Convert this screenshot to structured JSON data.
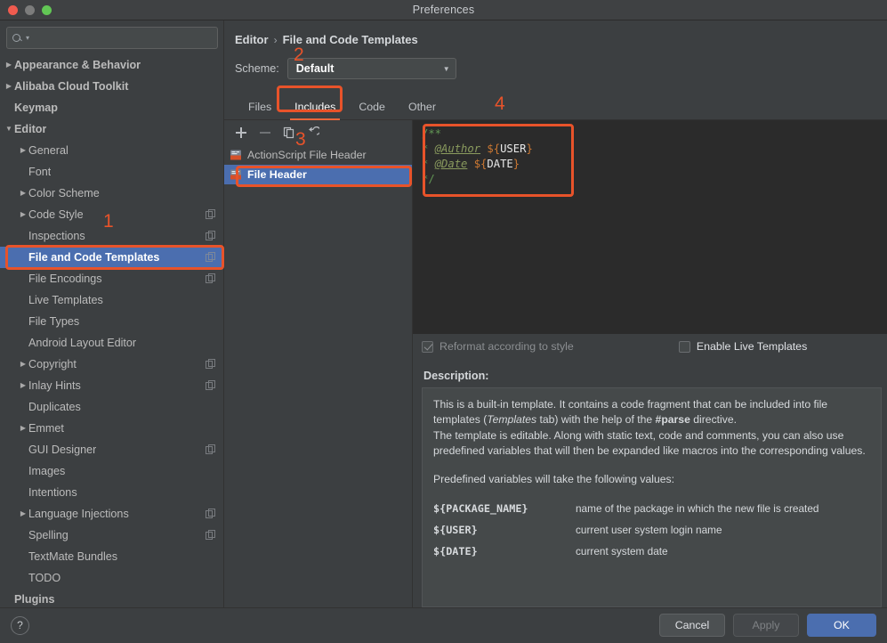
{
  "window": {
    "title": "Preferences",
    "controls": [
      "close",
      "minimize",
      "zoom"
    ]
  },
  "search": {
    "value": "",
    "placeholder": ""
  },
  "sidebar": {
    "items": [
      {
        "label": "Appearance & Behavior",
        "level": 0,
        "arrow": "collapsed",
        "bold": true,
        "cfg": false,
        "selected": false
      },
      {
        "label": "Alibaba Cloud Toolkit",
        "level": 0,
        "arrow": "collapsed",
        "bold": true,
        "cfg": false,
        "selected": false
      },
      {
        "label": "Keymap",
        "level": 0,
        "arrow": "none",
        "bold": true,
        "cfg": false,
        "selected": false
      },
      {
        "label": "Editor",
        "level": 0,
        "arrow": "expanded",
        "bold": true,
        "cfg": false,
        "selected": false
      },
      {
        "label": "General",
        "level": 1,
        "arrow": "collapsed",
        "bold": false,
        "cfg": false,
        "selected": false
      },
      {
        "label": "Font",
        "level": 1,
        "arrow": "none",
        "bold": false,
        "cfg": false,
        "selected": false
      },
      {
        "label": "Color Scheme",
        "level": 1,
        "arrow": "collapsed",
        "bold": false,
        "cfg": false,
        "selected": false
      },
      {
        "label": "Code Style",
        "level": 1,
        "arrow": "collapsed",
        "bold": false,
        "cfg": true,
        "selected": false
      },
      {
        "label": "Inspections",
        "level": 1,
        "arrow": "none",
        "bold": false,
        "cfg": true,
        "selected": false
      },
      {
        "label": "File and Code Templates",
        "level": 1,
        "arrow": "none",
        "bold": false,
        "cfg": true,
        "selected": true
      },
      {
        "label": "File Encodings",
        "level": 1,
        "arrow": "none",
        "bold": false,
        "cfg": true,
        "selected": false
      },
      {
        "label": "Live Templates",
        "level": 1,
        "arrow": "none",
        "bold": false,
        "cfg": false,
        "selected": false
      },
      {
        "label": "File Types",
        "level": 1,
        "arrow": "none",
        "bold": false,
        "cfg": false,
        "selected": false
      },
      {
        "label": "Android Layout Editor",
        "level": 1,
        "arrow": "none",
        "bold": false,
        "cfg": false,
        "selected": false
      },
      {
        "label": "Copyright",
        "level": 1,
        "arrow": "collapsed",
        "bold": false,
        "cfg": true,
        "selected": false
      },
      {
        "label": "Inlay Hints",
        "level": 1,
        "arrow": "collapsed",
        "bold": false,
        "cfg": true,
        "selected": false
      },
      {
        "label": "Duplicates",
        "level": 1,
        "arrow": "none",
        "bold": false,
        "cfg": false,
        "selected": false
      },
      {
        "label": "Emmet",
        "level": 1,
        "arrow": "collapsed",
        "bold": false,
        "cfg": false,
        "selected": false
      },
      {
        "label": "GUI Designer",
        "level": 1,
        "arrow": "none",
        "bold": false,
        "cfg": true,
        "selected": false
      },
      {
        "label": "Images",
        "level": 1,
        "arrow": "none",
        "bold": false,
        "cfg": false,
        "selected": false
      },
      {
        "label": "Intentions",
        "level": 1,
        "arrow": "none",
        "bold": false,
        "cfg": false,
        "selected": false
      },
      {
        "label": "Language Injections",
        "level": 1,
        "arrow": "collapsed",
        "bold": false,
        "cfg": true,
        "selected": false
      },
      {
        "label": "Spelling",
        "level": 1,
        "arrow": "none",
        "bold": false,
        "cfg": true,
        "selected": false
      },
      {
        "label": "TextMate Bundles",
        "level": 1,
        "arrow": "none",
        "bold": false,
        "cfg": false,
        "selected": false
      },
      {
        "label": "TODO",
        "level": 1,
        "arrow": "none",
        "bold": false,
        "cfg": false,
        "selected": false
      },
      {
        "label": "Plugins",
        "level": 0,
        "arrow": "none",
        "bold": true,
        "cfg": false,
        "selected": false
      }
    ]
  },
  "main": {
    "breadcrumb": {
      "parent": "Editor",
      "separator": "›",
      "current": "File and Code Templates"
    },
    "scheme": {
      "label": "Scheme:",
      "value": "Default",
      "arrow": "▼"
    },
    "tabs": [
      {
        "label": "Files",
        "active": false
      },
      {
        "label": "Includes",
        "active": true
      },
      {
        "label": "Code",
        "active": false
      },
      {
        "label": "Other",
        "active": false
      }
    ],
    "list_toolbar": [
      {
        "name": "add",
        "glyph": "+",
        "enabled": true
      },
      {
        "name": "remove",
        "glyph": "−",
        "enabled": false
      },
      {
        "name": "copy",
        "glyph": "copy",
        "enabled": true
      },
      {
        "name": "reset",
        "glyph": "revert",
        "enabled": true
      }
    ],
    "templates": [
      {
        "label": "ActionScript File Header",
        "selected": false
      },
      {
        "label": "File Header",
        "selected": true
      }
    ],
    "code": {
      "lines": [
        {
          "segments": [
            {
              "text": "/**",
              "cls": "c-comment"
            }
          ]
        },
        {
          "segments": [
            {
              "text": " * ",
              "cls": "c-comment"
            },
            {
              "text": "@Author",
              "cls": "c-tag"
            },
            {
              "text": " ",
              "cls": "c-comment"
            },
            {
              "text": "${",
              "cls": "c-var"
            },
            {
              "text": "USER",
              "cls": "c-varname"
            },
            {
              "text": "}",
              "cls": "c-var"
            }
          ]
        },
        {
          "segments": [
            {
              "text": " * ",
              "cls": "c-comment"
            },
            {
              "text": "@Date",
              "cls": "c-tag"
            },
            {
              "text": " ",
              "cls": "c-comment"
            },
            {
              "text": "${",
              "cls": "c-var"
            },
            {
              "text": "DATE",
              "cls": "c-varname"
            },
            {
              "text": "}",
              "cls": "c-var"
            }
          ]
        },
        {
          "segments": [
            {
              "text": " */",
              "cls": "c-comment"
            }
          ]
        }
      ]
    },
    "options": {
      "reformat": {
        "label": "Reformat according to style",
        "checked": true,
        "enabled": false
      },
      "live_templates": {
        "label": "Enable Live Templates",
        "checked": false,
        "enabled": true
      }
    },
    "description": {
      "label": "Description:",
      "para1_a": "This is a built-in template. It contains a code fragment that can be included into file templates (",
      "para1_i": "Templates",
      "para1_b": " tab) with the help of the ",
      "para1_c": "#parse",
      "para1_d": " directive.",
      "para2": "The template is editable. Along with static text, code and comments, you can also use predefined variables that will then be expanded like macros into the corresponding values.",
      "para3": "Predefined variables will take the following values:",
      "variables": [
        {
          "name": "${PACKAGE_NAME}",
          "desc": "name of the package in which the new file is created"
        },
        {
          "name": "${USER}",
          "desc": "current user system login name"
        },
        {
          "name": "${DATE}",
          "desc": "current system date"
        }
      ]
    }
  },
  "footer": {
    "help": "?",
    "cancel": "Cancel",
    "apply": "Apply",
    "ok": "OK"
  },
  "annotations": {
    "accent": "#e8532a",
    "markers": [
      {
        "number": "1",
        "target": "sidebar-file-and-code-templates"
      },
      {
        "number": "2",
        "target": "scheme-combo"
      },
      {
        "number": "3",
        "target": "template-file-header"
      },
      {
        "number": "4",
        "target": "code-editor"
      }
    ]
  }
}
